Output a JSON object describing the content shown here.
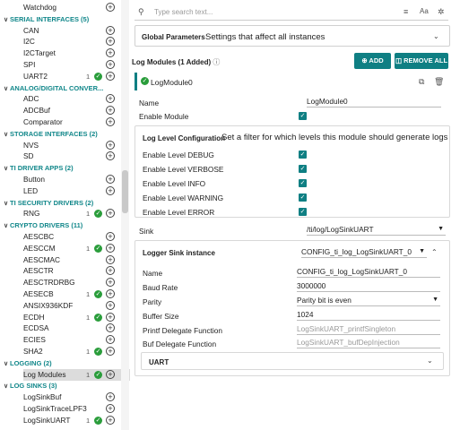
{
  "sidebar": {
    "rows": [
      {
        "kind": "item",
        "label": "Watchdog",
        "count": "",
        "added": false
      },
      {
        "kind": "cat",
        "label": "SERIAL INTERFACES (5)"
      },
      {
        "kind": "item",
        "label": "CAN",
        "count": "",
        "added": false
      },
      {
        "kind": "item",
        "label": "I2C",
        "count": "",
        "added": false
      },
      {
        "kind": "item",
        "label": "I2CTarget",
        "count": "",
        "added": false
      },
      {
        "kind": "item",
        "label": "SPI",
        "count": "",
        "added": false
      },
      {
        "kind": "item",
        "label": "UART2",
        "count": "1",
        "added": true
      },
      {
        "kind": "cat",
        "label": "ANALOG/DIGITAL CONVER..."
      },
      {
        "kind": "item",
        "label": "ADC",
        "count": "",
        "added": false
      },
      {
        "kind": "item",
        "label": "ADCBuf",
        "count": "",
        "added": false
      },
      {
        "kind": "item",
        "label": "Comparator",
        "count": "",
        "added": false
      },
      {
        "kind": "cat",
        "label": "STORAGE INTERFACES (2)"
      },
      {
        "kind": "item",
        "label": "NVS",
        "count": "",
        "added": false
      },
      {
        "kind": "item",
        "label": "SD",
        "count": "",
        "added": false
      },
      {
        "kind": "cat",
        "label": "TI DRIVER APPS (2)"
      },
      {
        "kind": "item",
        "label": "Button",
        "count": "",
        "added": false
      },
      {
        "kind": "item",
        "label": "LED",
        "count": "",
        "added": false
      },
      {
        "kind": "cat",
        "label": "TI SECURITY DRIVERS (2)"
      },
      {
        "kind": "item",
        "label": "RNG",
        "count": "1",
        "added": true
      },
      {
        "kind": "cat",
        "label": "CRYPTO DRIVERS (11)"
      },
      {
        "kind": "item",
        "label": "AESCBC",
        "count": "",
        "added": false
      },
      {
        "kind": "item",
        "label": "AESCCM",
        "count": "1",
        "added": true
      },
      {
        "kind": "item",
        "label": "AESCMAC",
        "count": "",
        "added": false
      },
      {
        "kind": "item",
        "label": "AESCTR",
        "count": "",
        "added": false
      },
      {
        "kind": "item",
        "label": "AESCTRDRBG",
        "count": "",
        "added": false
      },
      {
        "kind": "item",
        "label": "AESECB",
        "count": "1",
        "added": true
      },
      {
        "kind": "item",
        "label": "ANSIX936KDF",
        "count": "",
        "added": false
      },
      {
        "kind": "item",
        "label": "ECDH",
        "count": "1",
        "added": true
      },
      {
        "kind": "item",
        "label": "ECDSA",
        "count": "",
        "added": false
      },
      {
        "kind": "item",
        "label": "ECIES",
        "count": "",
        "added": false
      },
      {
        "kind": "item",
        "label": "SHA2",
        "count": "1",
        "added": true
      },
      {
        "kind": "cat",
        "label": "LOGGING (2)"
      },
      {
        "kind": "item",
        "label": "Log Modules",
        "count": "1",
        "added": true,
        "selected": true
      },
      {
        "kind": "cat",
        "label": "LOG SINKS (3)"
      },
      {
        "kind": "item",
        "label": "LogSinkBuf",
        "count": "",
        "added": false
      },
      {
        "kind": "item",
        "label": "LogSinkTraceLPF3",
        "count": "",
        "added": false
      },
      {
        "kind": "item",
        "label": "LogSinkUART",
        "count": "1",
        "added": true
      }
    ]
  },
  "search": {
    "placeholder": "Type search text..."
  },
  "global": {
    "title": "Global Parameters",
    "desc": "Settings that affect all instances"
  },
  "modules": {
    "header": "Log Modules (1 Added)",
    "add_label": "ADD",
    "remove_label": "REMOVE ALL",
    "instance": "LogModule0"
  },
  "form": {
    "name_label": "Name",
    "name_value": "LogModule0",
    "enable_label": "Enable Module",
    "loglevel_title": "Log Level Configuration",
    "loglevel_desc": "Set a filter for which levels this module should generate logs",
    "levels": [
      "Enable Level DEBUG",
      "Enable Level VERBOSE",
      "Enable Level INFO",
      "Enable Level WARNING",
      "Enable Level ERROR"
    ],
    "sink_label": "Sink",
    "sink_value": "/ti/log/LogSinkUART"
  },
  "sink": {
    "title": "Logger Sink instance",
    "select_value": "CONFIG_ti_log_LogSinkUART_0",
    "name_label": "Name",
    "name_value": "CONFIG_ti_log_LogSinkUART_0",
    "baud_label": "Baud Rate",
    "baud_value": "3000000",
    "parity_label": "Parity",
    "parity_value": "Parity bit is even",
    "buffer_label": "Buffer Size",
    "buffer_value": "1024",
    "printf_label": "Printf Delegate Function",
    "printf_value": "LogSinkUART_printfSingleton",
    "bufdel_label": "Buf Delegate Function",
    "bufdel_value": "LogSinkUART_bufDepInjection",
    "uart_title": "UART"
  },
  "colors": {
    "accent": "#0f7f83",
    "category": "#11878a",
    "check": "#2a9d3b"
  }
}
